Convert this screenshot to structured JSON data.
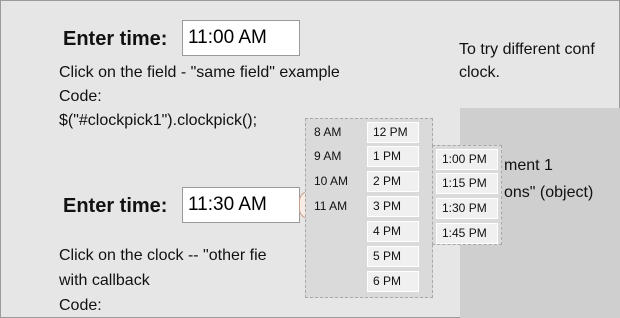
{
  "example1": {
    "label": "Enter time:",
    "value": "11:00 AM",
    "description": "Click on the field - \"same field\" example",
    "code_label": "Code:",
    "code": "$(\"#clockpick1\").clockpick();"
  },
  "example2": {
    "label": "Enter time:",
    "value": "11:30 AM",
    "description_line1": "Click on the clock -- \"other fie",
    "description_line2": "with callback",
    "code_label": "Code:"
  },
  "side_text": {
    "line1": "To try different conf",
    "line2": "clock.",
    "arg_line1": "ment 1",
    "arg_line2": "ons\" (object)"
  },
  "picker": {
    "am_hours": [
      "8 AM",
      "9 AM",
      "10 AM",
      "11 AM"
    ],
    "pm_hours": [
      "12 PM",
      "1 PM",
      "2 PM",
      "3 PM",
      "4 PM",
      "5 PM",
      "6 PM"
    ],
    "minutes": [
      "1:00 PM",
      "1:15 PM",
      "1:30 PM",
      "1:45 PM"
    ]
  },
  "icons": {
    "clock_button": "clock-icon"
  }
}
